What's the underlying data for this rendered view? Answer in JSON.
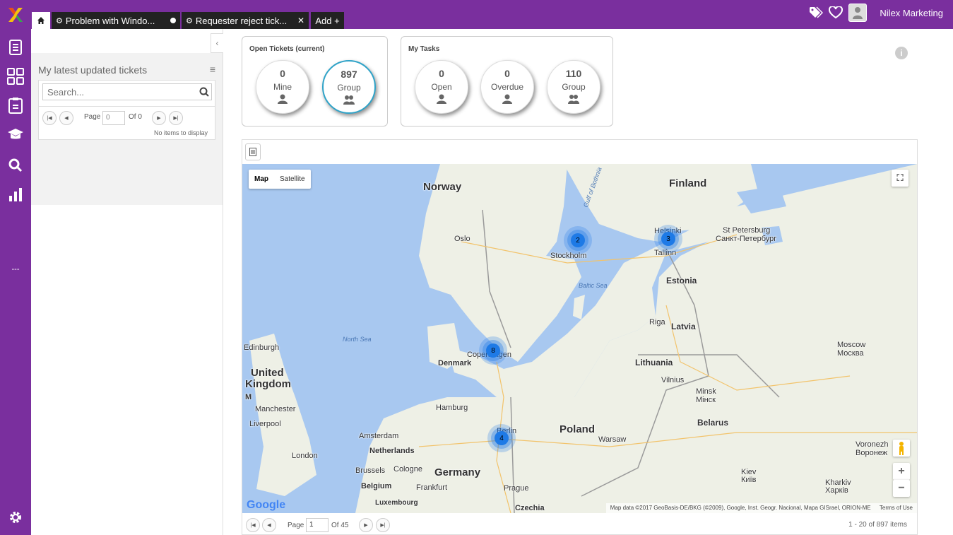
{
  "tabs": {
    "home_icon": "home-icon",
    "items": [
      {
        "label": "Problem with Windo...",
        "state": "unsaved"
      },
      {
        "label": "Requester reject tick...",
        "state": "closable"
      }
    ],
    "add_label": "Add +"
  },
  "header": {
    "user_name": "Nilex Marketing"
  },
  "leftnav": {
    "items": [
      "document-icon",
      "dashboard-icon",
      "clipboard-icon",
      "graduation-cap-icon",
      "search-icon",
      "bar-chart-icon"
    ],
    "divider": "---",
    "settings": "gear-icon"
  },
  "sidebar": {
    "title": "My latest updated tickets",
    "search_placeholder": "Search...",
    "pager": {
      "page_label": "Page",
      "page_value": "0",
      "of_label": "Of 0",
      "empty": "No items to display"
    }
  },
  "open_tickets": {
    "title": "Open Tickets (current)",
    "items": [
      {
        "value": "0",
        "label": "Mine"
      },
      {
        "value": "897",
        "label": "Group"
      }
    ]
  },
  "my_tasks": {
    "title": "My Tasks",
    "items": [
      {
        "value": "0",
        "label": "Open"
      },
      {
        "value": "0",
        "label": "Overdue"
      },
      {
        "value": "110",
        "label": "Group"
      }
    ]
  },
  "map": {
    "types": [
      "Map",
      "Satellite"
    ],
    "countries": {
      "norway": "Norway",
      "finland": "Finland",
      "estonia": "Estonia",
      "latvia": "Latvia",
      "lithuania": "Lithuania",
      "belarus": "Belarus",
      "poland": "Poland",
      "germany": "Germany",
      "denmark": "Denmark",
      "uk1": "United",
      "uk2": "Kingdom",
      "netherlands": "Netherlands",
      "belgium": "Belgium",
      "czechia": "Czechia",
      "luxembourg": "Luxembourg"
    },
    "cities": {
      "oslo": "Oslo",
      "stockholm": "Stockholm",
      "helsinki": "Helsinki",
      "tallinn": "Tallinn",
      "stp1": "St Petersburg",
      "stp2": "Санкт-Петербург",
      "riga": "Riga",
      "vilnius": "Vilnius",
      "minsk1": "Minsk",
      "minsk2": "Мінск",
      "moscow1": "Moscow",
      "moscow2": "Москва",
      "edinburgh": "Edinburgh",
      "copenhagen": "Copenhagen",
      "hamburg": "Hamburg",
      "amsterdam": "Amsterdam",
      "manchester": "Manchester",
      "liverpool": "Liverpool",
      "london": "London",
      "brussels": "Brussels",
      "cologne": "Cologne",
      "frankfurt": "Frankfurt",
      "prague": "Prague",
      "warsaw": "Warsaw",
      "berlin": "Berlin",
      "kiev1": "Kiev",
      "kiev2": "Київ",
      "kharkiv1": "Kharkiv",
      "kharkiv2": "Харків",
      "voronezh1": "Voronezh",
      "voronezh2": "Воронеж",
      "iom": "M"
    },
    "seas": {
      "north": "North Sea",
      "baltic": "Baltic Sea",
      "bothnia": "Gulf of Bothnia"
    },
    "clusters": [
      {
        "count": "2",
        "place": "Stockholm"
      },
      {
        "count": "3",
        "place": "Helsinki"
      },
      {
        "count": "8",
        "place": "Copenhagen"
      },
      {
        "count": "4",
        "place": "Berlin"
      }
    ],
    "google": "Google",
    "attribution": "Map data ©2017 GeoBasis-DE/BKG (©2009), Google, Inst. Geogr. Nacional, Mapa GISrael, ORION-ME",
    "terms": "Terms of Use"
  },
  "map_pager": {
    "page_label": "Page",
    "page_value": "1",
    "of_label": "Of 45",
    "items": "1 - 20 of 897 items"
  }
}
